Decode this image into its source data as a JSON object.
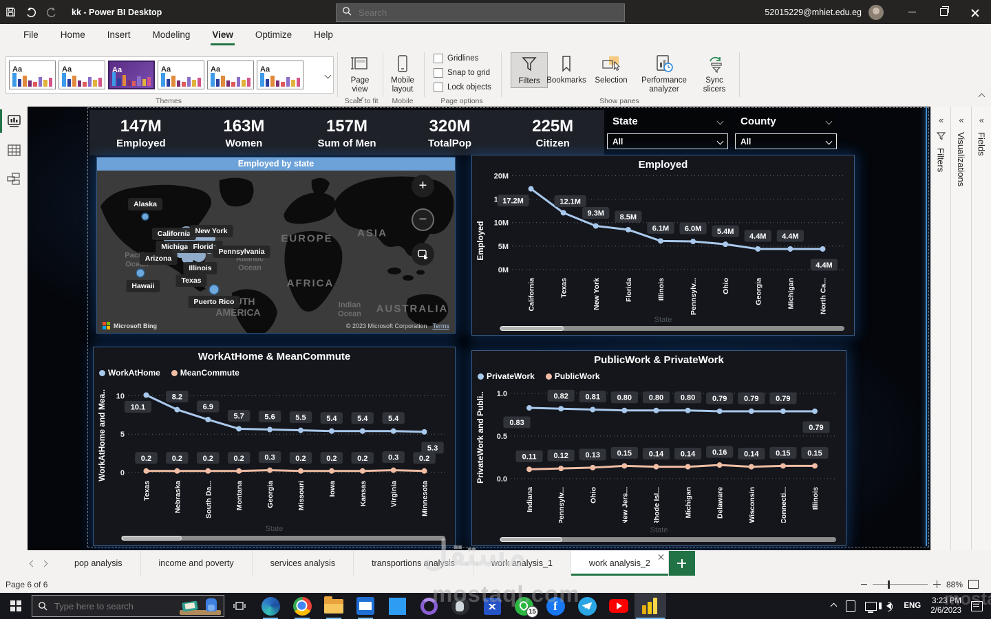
{
  "titlebar": {
    "title": "kk - Power BI Desktop",
    "search_placeholder": "Search",
    "account": "52015229@mhiet.edu.eg"
  },
  "menu": {
    "items": [
      "File",
      "Home",
      "Insert",
      "Modeling",
      "View",
      "Optimize",
      "Help"
    ],
    "active": "View"
  },
  "ribbon": {
    "theme_thumb_text": "Aa",
    "groups": {
      "themes": "Themes",
      "scale_to_fit": "Scale to fit",
      "mobile": "Mobile",
      "page_options": "Page options",
      "show_panes": "Show panes"
    },
    "buttons": {
      "page_view": "Page view",
      "mobile_layout": "Mobile layout",
      "filters": "Filters",
      "bookmarks": "Bookmarks",
      "selection": "Selection",
      "performance_analyzer": "Performance analyzer",
      "sync_slicers": "Sync slicers"
    },
    "checkboxes": [
      "Gridlines",
      "Snap to grid",
      "Lock objects"
    ]
  },
  "canvas": {
    "kpis": [
      {
        "value": "147M",
        "label": "Employed"
      },
      {
        "value": "163M",
        "label": "Women"
      },
      {
        "value": "157M",
        "label": "Sum of Men"
      },
      {
        "value": "320M",
        "label": "TotalPop"
      },
      {
        "value": "225M",
        "label": "Citizen"
      }
    ],
    "slicers": [
      {
        "title": "State",
        "value": "All"
      },
      {
        "title": "County",
        "value": "All"
      }
    ],
    "map": {
      "title": "Employed by state",
      "state_labels": [
        "Alaska",
        "California",
        "New York",
        "Michigan",
        "Florida",
        "Pennsylvania",
        "Arizona",
        "Illinois",
        "Texas",
        "Hawaii",
        "Puerto Rico"
      ],
      "geo_labels": [
        "Pacific Ocean",
        "Atlantic Ocean",
        "EUROPE",
        "ASIA",
        "AFRICA",
        "SOUTH AMERICA",
        "Indian Ocean",
        "AUSTRALIA"
      ],
      "attribution": "Microsoft Bing",
      "copyright": "© 2023 Microsoft Corporation",
      "terms": "Terms"
    }
  },
  "chart_data": [
    {
      "id": "employed",
      "type": "line",
      "title": "Employed",
      "ylabel": "Employed",
      "xlabel": "State",
      "ylim": [
        0,
        20000000
      ],
      "grid": "dotted",
      "legend_position": "none",
      "yticks": [
        {
          "v": 0,
          "label": "0M"
        },
        {
          "v": 5,
          "label": "5M"
        },
        {
          "v": 10,
          "label": "10M"
        },
        {
          "v": 15,
          "label": "15M"
        },
        {
          "v": 20,
          "label": "20M"
        }
      ],
      "categories": [
        "California",
        "Texas",
        "New York",
        "Florida",
        "Illinois",
        "Pennsylv...",
        "Ohio",
        "Georgia",
        "Michigan",
        "North Ca..."
      ],
      "series": [
        {
          "name": "Employed",
          "color": "#a9c9ec",
          "unit": "millions",
          "values": [
            17.2,
            12.1,
            9.3,
            8.5,
            6.1,
            6.0,
            5.4,
            4.4,
            4.4,
            4.4
          ],
          "labels": [
            "17.2M",
            "12.1M",
            "9.3M",
            "8.5M",
            "6.1M",
            "6.0M",
            "5.4M",
            "4.4M",
            "4.4M",
            "4.4M"
          ]
        }
      ]
    },
    {
      "id": "workathome-meancommute",
      "type": "line",
      "title": "WorkAtHome & MeanCommute",
      "ylabel": "WorkAtHome and Mea..",
      "xlabel": "State",
      "ylim": [
        0,
        10
      ],
      "grid": "dotted",
      "legend_position": "top-left",
      "yticks": [
        {
          "v": 0,
          "label": "0"
        },
        {
          "v": 5,
          "label": "5"
        },
        {
          "v": 10,
          "label": "10"
        }
      ],
      "categories": [
        "Texas",
        "Nebraska",
        "South Da...",
        "Montana",
        "Georgia",
        "Missouri",
        "Iowa",
        "Kansas",
        "Virginia",
        "Minnesota"
      ],
      "series": [
        {
          "name": "WorkAtHome",
          "color": "#a9c9ec",
          "values": [
            10.1,
            8.2,
            6.9,
            5.7,
            5.6,
            5.5,
            5.4,
            5.4,
            5.4,
            5.3
          ],
          "labels": [
            "10.1",
            "8.2",
            "6.9",
            "5.7",
            "5.6",
            "5.5",
            "5.4",
            "5.4",
            "5.4",
            "5.3"
          ]
        },
        {
          "name": "MeanCommute",
          "color": "#f0bda4",
          "values": [
            0.2,
            0.2,
            0.2,
            0.2,
            0.3,
            0.2,
            0.2,
            0.2,
            0.3,
            0.2
          ],
          "labels": [
            "0.2",
            "0.2",
            "0.2",
            "0.2",
            "0.3",
            "0.2",
            "0.2",
            "0.2",
            "0.3",
            "0.2"
          ]
        }
      ]
    },
    {
      "id": "publicwork-privatework",
      "type": "line",
      "title": "PublicWork & PrivateWork",
      "ylabel": "PrivateWork and Publi..",
      "xlabel": "State",
      "ylim": [
        0,
        1
      ],
      "grid": "dotted",
      "legend_position": "top-left",
      "yticks": [
        {
          "v": 0,
          "label": "0.0"
        },
        {
          "v": 0.5,
          "label": "0.5"
        },
        {
          "v": 1.0,
          "label": "1.0"
        }
      ],
      "categories": [
        "Indiana",
        "Pennsylv...",
        "Ohio",
        "New Jers...",
        "Rhode Isl...",
        "Michigan",
        "Delaware",
        "Wisconsin",
        "Connecti...",
        "Illinois"
      ],
      "series": [
        {
          "name": "PrivateWork",
          "color": "#a9c9ec",
          "values": [
            0.83,
            0.82,
            0.81,
            0.8,
            0.8,
            0.8,
            0.79,
            0.79,
            0.79,
            0.79
          ],
          "labels": [
            "0.83",
            "0.82",
            "0.81",
            "0.80",
            "0.80",
            "0.80",
            "0.79",
            "0.79",
            "0.79",
            "0.79"
          ]
        },
        {
          "name": "PublicWork",
          "color": "#f0bda4",
          "values": [
            0.11,
            0.12,
            0.13,
            0.15,
            0.14,
            0.14,
            0.16,
            0.14,
            0.15,
            0.15
          ],
          "labels": [
            "0.11",
            "0.12",
            "0.13",
            "0.15",
            "0.14",
            "0.14",
            "0.16",
            "0.14",
            "0.15",
            "0.15"
          ]
        }
      ]
    }
  ],
  "panes": {
    "filters": "Filters",
    "visualizations": "Visualizations",
    "fields": "Fields"
  },
  "tabs": {
    "items": [
      "pop analysis",
      "income and poverty",
      "services analysis",
      "transportions analysis",
      "work analysis_1",
      "work analysis_2"
    ],
    "active": "work analysis_2"
  },
  "statusbar": {
    "page_info": "Page 6 of 6",
    "zoom": "88%"
  },
  "taskbar": {
    "search_placeholder": "Type here to search",
    "whatsapp_badge": "15",
    "language": "ENG",
    "time": "3:23 PM",
    "date": "2/6/2023"
  },
  "watermark": {
    "arabic": "مستقل",
    "latin": "mostaql.com",
    "latin_partial": "mosta"
  },
  "colors": {
    "accent_green": "#217346",
    "line_blue": "#a9c9ec",
    "line_pink": "#f0bda4",
    "map_header": "#6da2d8",
    "powerbi_yellow": "#f2c811"
  }
}
